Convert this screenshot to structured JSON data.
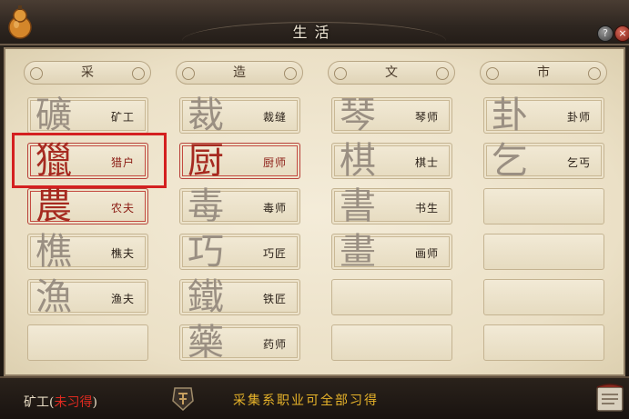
{
  "window": {
    "title": "生活"
  },
  "columns": [
    {
      "header": "采",
      "slots": [
        {
          "glyph": "礦",
          "label": "矿工",
          "state": "normal"
        },
        {
          "glyph": "獵",
          "label": "猎户",
          "state": "active"
        },
        {
          "glyph": "農",
          "label": "农夫",
          "state": "active"
        },
        {
          "glyph": "樵",
          "label": "樵夫",
          "state": "normal"
        },
        {
          "glyph": "漁",
          "label": "渔夫",
          "state": "normal"
        },
        {
          "glyph": "",
          "label": "",
          "state": "empty"
        }
      ]
    },
    {
      "header": "造",
      "slots": [
        {
          "glyph": "裁",
          "label": "裁缝",
          "state": "normal"
        },
        {
          "glyph": "厨",
          "label": "厨师",
          "state": "active"
        },
        {
          "glyph": "毒",
          "label": "毒师",
          "state": "normal"
        },
        {
          "glyph": "巧",
          "label": "巧匠",
          "state": "normal"
        },
        {
          "glyph": "鐵",
          "label": "铁匠",
          "state": "normal"
        },
        {
          "glyph": "藥",
          "label": "药师",
          "state": "normal"
        }
      ]
    },
    {
      "header": "文",
      "slots": [
        {
          "glyph": "琴",
          "label": "琴师",
          "state": "normal"
        },
        {
          "glyph": "棋",
          "label": "棋士",
          "state": "normal"
        },
        {
          "glyph": "書",
          "label": "书生",
          "state": "normal"
        },
        {
          "glyph": "畫",
          "label": "画师",
          "state": "normal"
        },
        {
          "glyph": "",
          "label": "",
          "state": "empty"
        },
        {
          "glyph": "",
          "label": "",
          "state": "empty"
        }
      ]
    },
    {
      "header": "市",
      "slots": [
        {
          "glyph": "卦",
          "label": "卦师",
          "state": "normal"
        },
        {
          "glyph": "乞",
          "label": "乞丐",
          "state": "normal"
        },
        {
          "glyph": "",
          "label": "",
          "state": "empty"
        },
        {
          "glyph": "",
          "label": "",
          "state": "empty"
        },
        {
          "glyph": "",
          "label": "",
          "state": "empty"
        },
        {
          "glyph": "",
          "label": "",
          "state": "empty"
        }
      ]
    }
  ],
  "footer": {
    "selected_name": "矿工",
    "paren_open": "(",
    "status": "未习得",
    "paren_close": ")",
    "hint": "采集系职业可全部习得"
  },
  "icons": {
    "window": "gourd-icon",
    "help": "help-icon",
    "close": "close-icon",
    "skill": "skill-seal-icon",
    "book": "book-icon"
  },
  "help_glyph": "?",
  "close_glyph": "×",
  "colors": {
    "active_red": "#a62a20",
    "hint_gold": "#e8b42a",
    "status_red": "#e02a20"
  }
}
